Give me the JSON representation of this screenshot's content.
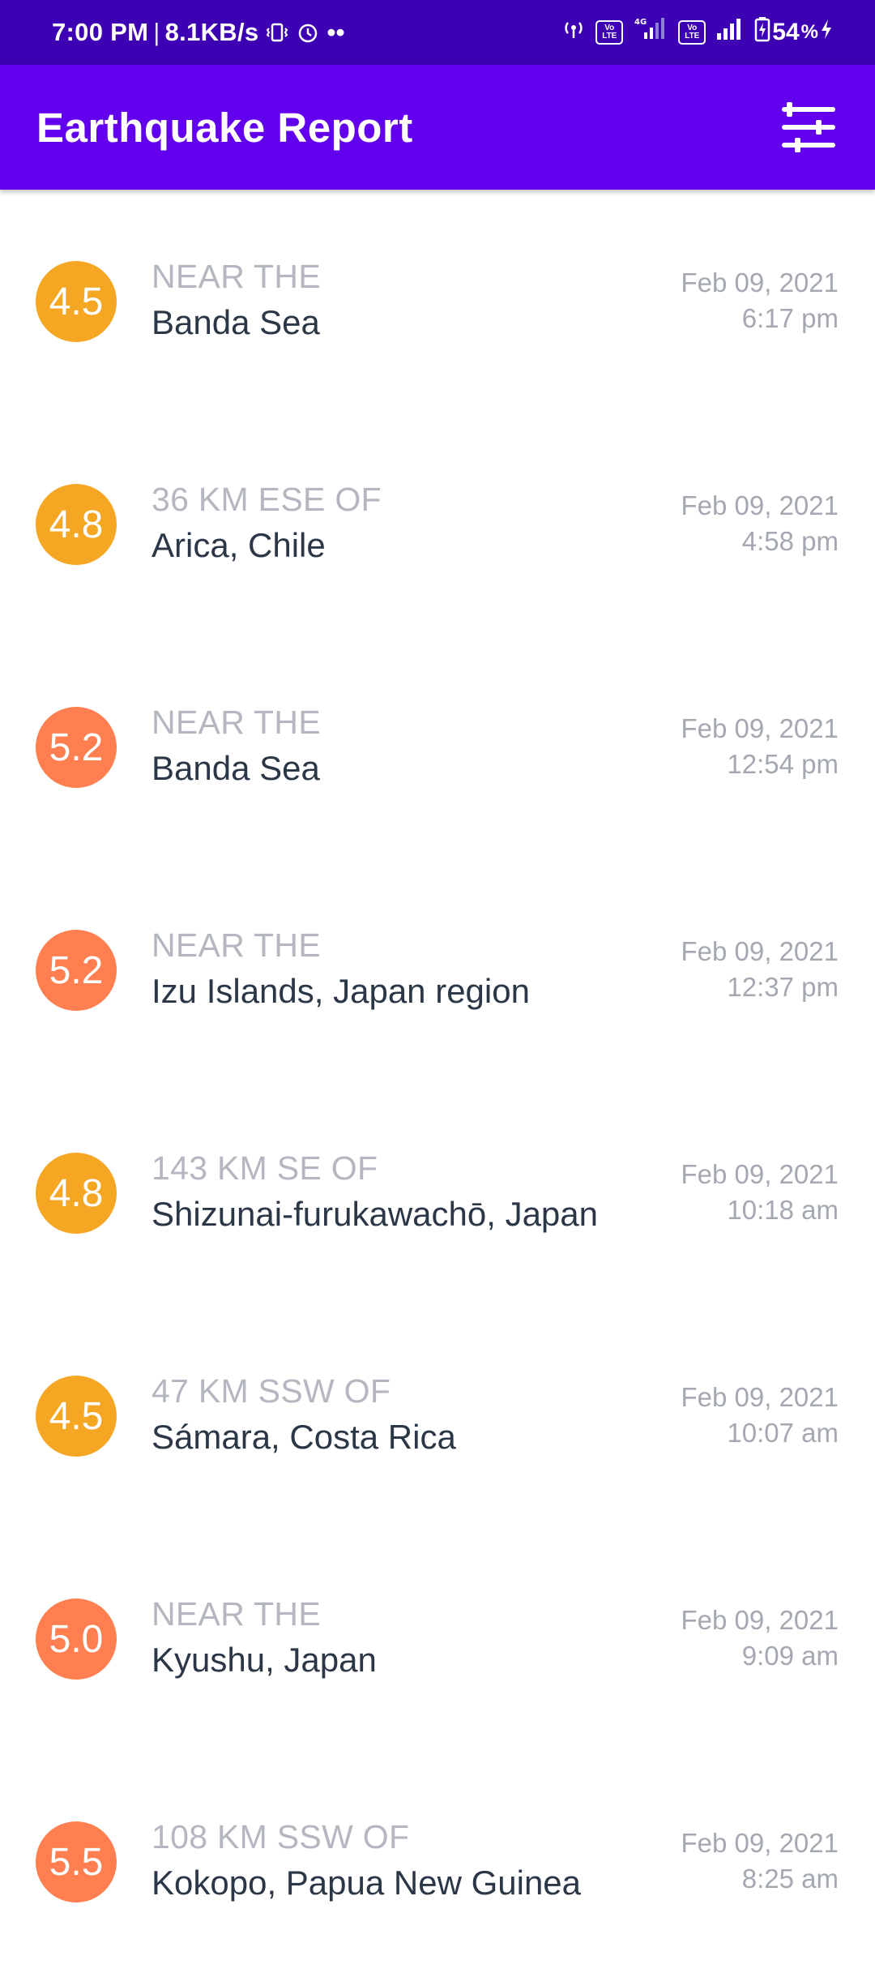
{
  "status_bar": {
    "time": "7:00 PM",
    "separator": "|",
    "speed": "8.1KB/s",
    "dots": "••",
    "volte_top": "Vo",
    "volte_bottom": "LTE",
    "network": "4G",
    "battery": "54",
    "battery_suffix": "%"
  },
  "app_bar": {
    "title": "Earthquake Report",
    "filter_icon": "tune-icon"
  },
  "colors": {
    "status_bar": "#3d00b3",
    "app_bar": "#6200ee",
    "mag_4": "#f5a623",
    "mag_5": "#ff7f50",
    "offset_text": "#b4b7bf",
    "primary_text": "#2b3747"
  },
  "earthquakes": [
    {
      "mag": "4.5",
      "offset": "NEAR THE",
      "place": "Banda Sea",
      "date": "Feb 09, 2021",
      "time": "6:17 pm",
      "color": "#f5a623"
    },
    {
      "mag": "4.8",
      "offset": "36 KM ESE OF",
      "place": "Arica, Chile",
      "date": "Feb 09, 2021",
      "time": "4:58 pm",
      "color": "#f5a623"
    },
    {
      "mag": "5.2",
      "offset": "NEAR THE",
      "place": "Banda Sea",
      "date": "Feb 09, 2021",
      "time": "12:54 pm",
      "color": "#ff7f50"
    },
    {
      "mag": "5.2",
      "offset": "NEAR THE",
      "place": "Izu Islands, Japan region",
      "date": "Feb 09, 2021",
      "time": "12:37 pm",
      "color": "#ff7f50"
    },
    {
      "mag": "4.8",
      "offset": "143 KM SE OF",
      "place": "Shizunai-furukawachō, Japan",
      "date": "Feb 09, 2021",
      "time": "10:18 am",
      "color": "#f5a623"
    },
    {
      "mag": "4.5",
      "offset": "47 KM SSW OF",
      "place": "Sámara, Costa Rica",
      "date": "Feb 09, 2021",
      "time": "10:07 am",
      "color": "#f5a623"
    },
    {
      "mag": "5.0",
      "offset": "NEAR THE",
      "place": "Kyushu, Japan",
      "date": "Feb 09, 2021",
      "time": "9:09 am",
      "color": "#ff7f50"
    },
    {
      "mag": "5.5",
      "offset": "108 KM SSW OF",
      "place": "Kokopo, Papua New Guinea",
      "date": "Feb 09, 2021",
      "time": "8:25 am",
      "color": "#ff7f50"
    }
  ]
}
